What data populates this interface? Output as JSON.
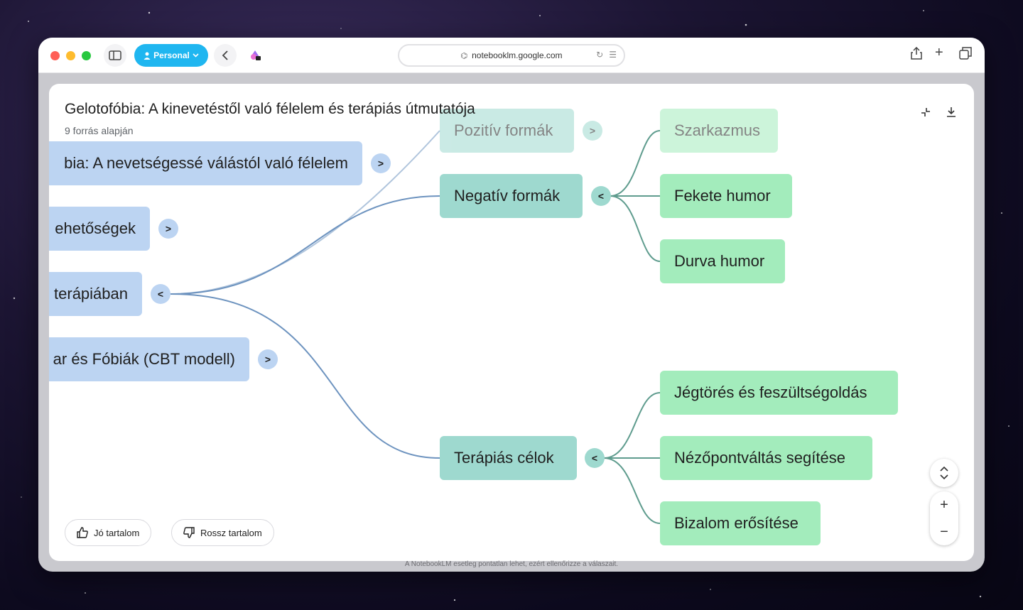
{
  "browser": {
    "profile_label": "Personal",
    "url": "notebooklm.google.com"
  },
  "panel": {
    "title": "Gelotofóbia: A kinevetéstől való félelem és terápiás útmutatója",
    "subtitle": "9 forrás alapján"
  },
  "mindmap": {
    "nodes": {
      "root_partial": "bia: A nevetségessé válástól való félelem",
      "possibilities_partial": "ehetőségek",
      "therapy_partial": "terápiában",
      "cbt_partial": "ar és Fóbiák (CBT modell)",
      "positive_forms": "Pozitív formák",
      "negative_forms": "Negatív formák",
      "therapy_goals": "Terápiás célok",
      "sarcasm": "Szarkazmus",
      "black_humor": "Fekete humor",
      "rude_humor": "Durva humor",
      "icebreaking": "Jégtörés és feszültségoldás",
      "perspective": "Nézőpontváltás segítése",
      "trust": "Bizalom erősítése"
    },
    "toggles": {
      "expand": ">",
      "collapse": "<"
    }
  },
  "feedback": {
    "good_label": "Jó tartalom",
    "bad_label": "Rossz tartalom"
  },
  "zoom": {
    "plus": "+",
    "minus": "−"
  },
  "disclaimer": "A NotebookLM esetleg pontatlan lehet, ezért ellenőrizze a válaszait.",
  "colors": {
    "blue_node": "#bcd4f2",
    "teal_node": "#9ed9cf",
    "green_node": "#a3ecbc",
    "blue_edge": "#6d93bf",
    "teal_edge": "#5f9c8e",
    "profile": "#1fb6f0"
  }
}
